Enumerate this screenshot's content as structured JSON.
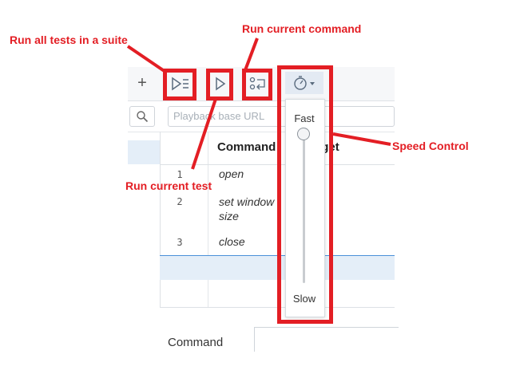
{
  "toolbar": {
    "add_label": "+",
    "icons": [
      "run-all-tests-icon",
      "run-current-test-icon",
      "run-current-command-icon",
      "speed-control-icon"
    ]
  },
  "search": {
    "placeholder": "Playback base URL"
  },
  "table": {
    "headers": {
      "command": "Command",
      "target": "Target"
    },
    "rows": [
      {
        "num": "1",
        "command": "open"
      },
      {
        "num": "2",
        "command": "set window size"
      },
      {
        "num": "3",
        "command": "close"
      }
    ]
  },
  "speed": {
    "fast_label": "Fast",
    "slow_label": "Slow"
  },
  "bottom": {
    "command_label": "Command"
  },
  "annotations": {
    "run_all": "Run all tests in a suite",
    "run_current_command": "Run current command",
    "run_current_test": "Run current test",
    "speed_control": "Speed Control"
  },
  "colors": {
    "annotation": "#e31e24",
    "selection": "#e4eef8",
    "accent": "#4a90d9"
  }
}
